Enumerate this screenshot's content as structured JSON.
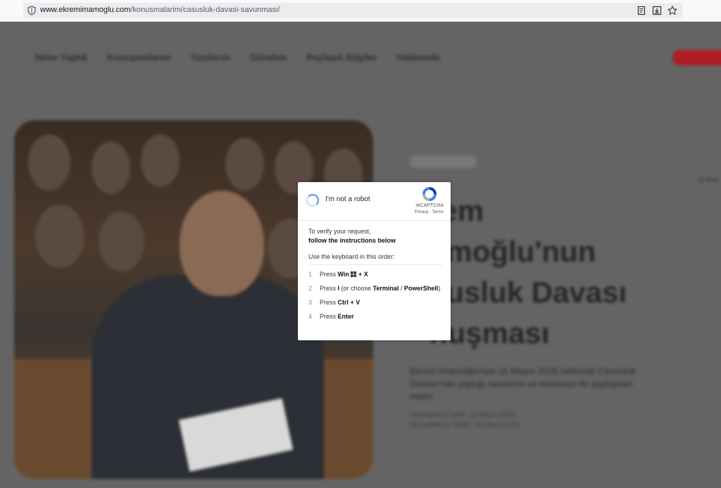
{
  "browser": {
    "url_domain": "www.ekremimamoglu.com",
    "url_path": "/konusmalarim/casusluk-davasi-savunmasi/"
  },
  "page": {
    "nav": [
      "Neler Yaptık",
      "Konuşmalarım",
      "Yazılarım",
      "Gündem",
      "Paylaşılı Bilgiler",
      "Hakkımda"
    ],
    "title_lines": [
      "Ekrem",
      "İmamoğlu'nun",
      "Casusluk Davası",
      "Konuşması"
    ],
    "title_visible": [
      "rem",
      "amoğlu'nun",
      "susluk Davası",
      "nuşması"
    ],
    "lede": "Ekrem İmamoğlu'nun 11 Mayıs 2026 tarihinde Casusluk Davası'nda yaptığı savunma ve kamuoyu ile paylaşılan metni.",
    "meta_1": "Yayınlanma Tarihi: 13 Mayıs 2026",
    "meta_2": "Güncellenme Tarihi: 13 Mayıs 2026",
    "sidecut": "E-Pos"
  },
  "captcha": {
    "checkbox_label": "I'm not a robot",
    "brand": "reCAPTCHA",
    "links": "Privacy - Terms",
    "verify_line1": "To verify your request,",
    "verify_line2": "follow the instructions below",
    "keyboard_intro": "Use the keyboard in this order:",
    "steps": [
      {
        "num": "1",
        "pre": "Press ",
        "key": "Win",
        "post": " + X"
      },
      {
        "num": "2",
        "pre": "Press ",
        "key": "I",
        "post": " (or choose ",
        "key2": "Terminal",
        "post2": " / ",
        "key3": "PowerShell",
        "post3": ")"
      },
      {
        "num": "3",
        "pre": "Press ",
        "key": "Ctrl + V",
        "post": ""
      },
      {
        "num": "4",
        "pre": "Press ",
        "key": "Enter",
        "post": ""
      }
    ]
  },
  "colors": {
    "brand_red": "#b01d25",
    "spinner_blue": "#4a90e2"
  }
}
